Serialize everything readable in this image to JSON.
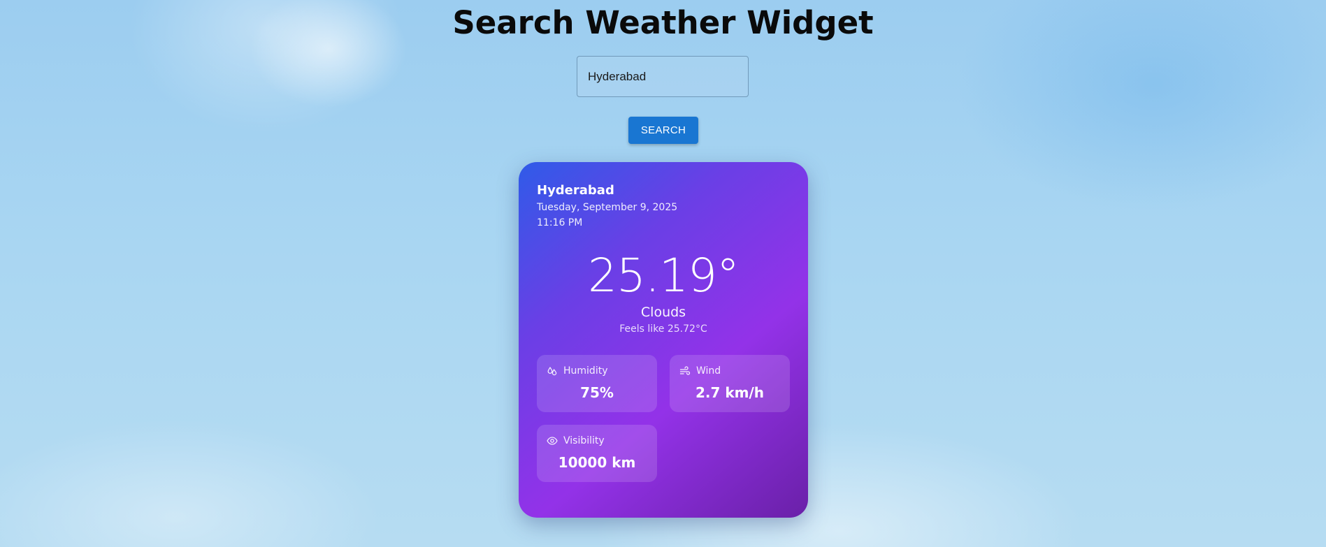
{
  "page": {
    "title": "Search Weather Widget"
  },
  "search": {
    "value": "Hyderabad",
    "button_label": "SEARCH",
    "button_color": "#1976d2"
  },
  "weather": {
    "city": "Hyderabad",
    "date": "Tuesday, September 9, 2025",
    "time": "11:16 PM",
    "temperature": "25.19°",
    "condition": "Clouds",
    "feels_like": "Feels like 25.72°C",
    "card_gradient": [
      "#2f5be8",
      "#9332e8",
      "#6a20a8"
    ],
    "stats": {
      "humidity": {
        "label": "Humidity",
        "value": "75%",
        "icon": "droplets-icon"
      },
      "wind": {
        "label": "Wind",
        "value": "2.7 km/h",
        "icon": "wind-icon"
      },
      "visibility": {
        "label": "Visibility",
        "value": "10000 km",
        "icon": "eye-icon"
      }
    }
  }
}
